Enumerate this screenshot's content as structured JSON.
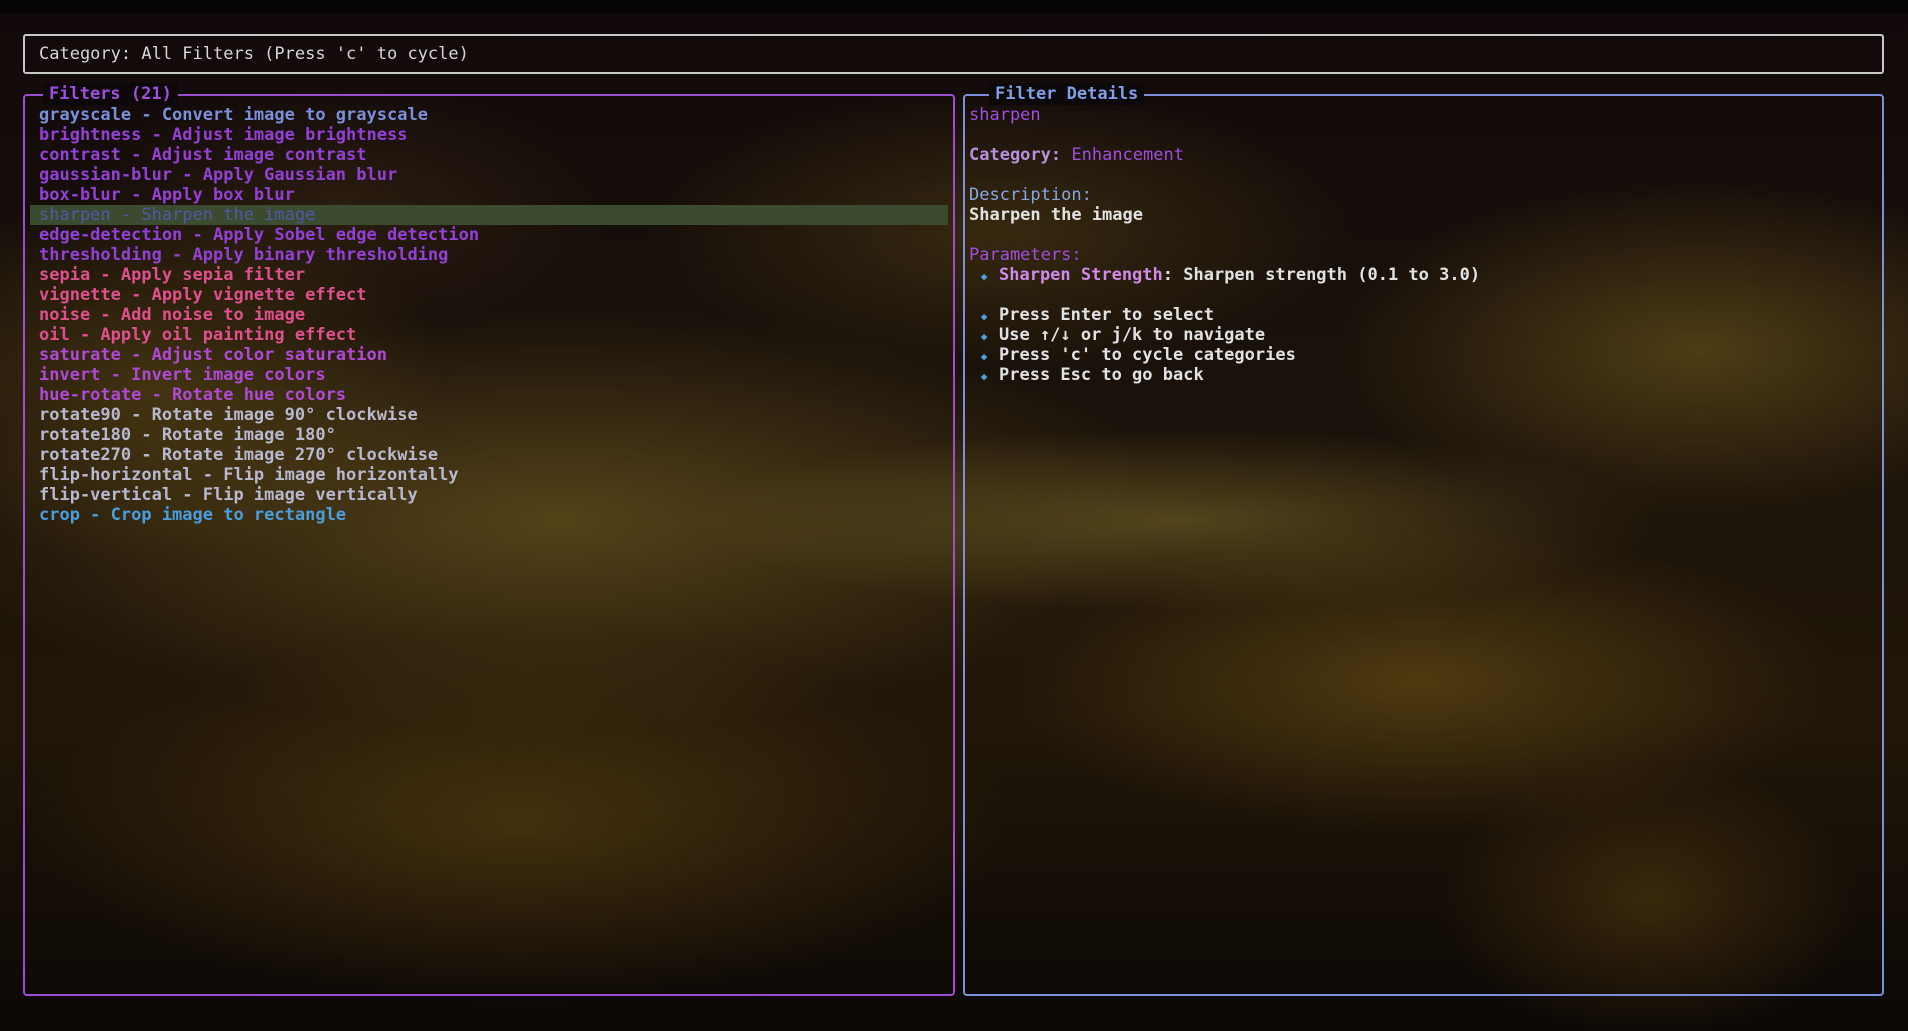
{
  "category_bar": {
    "text": "Category: All Filters (Press 'c' to cycle)"
  },
  "filters_panel": {
    "title": "Filters (21)",
    "selected_index": 5,
    "items": [
      {
        "text": "grayscale - Convert image to grayscale",
        "color": "#7b8fdc"
      },
      {
        "text": "brightness - Adjust image brightness",
        "color": "#9440d8"
      },
      {
        "text": "contrast - Adjust image contrast",
        "color": "#9440d8"
      },
      {
        "text": "gaussian-blur - Apply Gaussian blur",
        "color": "#9440d8"
      },
      {
        "text": "box-blur - Apply box blur",
        "color": "#9440d8"
      },
      {
        "text": "sharpen - Sharpen the image",
        "color": "#4f5aa8"
      },
      {
        "text": "edge-detection - Apply Sobel edge detection",
        "color": "#9440d8"
      },
      {
        "text": "thresholding - Apply binary thresholding",
        "color": "#9440d8"
      },
      {
        "text": "sepia - Apply sepia filter",
        "color": "#e0508e"
      },
      {
        "text": "vignette - Apply vignette effect",
        "color": "#e0508e"
      },
      {
        "text": "noise - Add noise to image",
        "color": "#e0508e"
      },
      {
        "text": "oil - Apply oil painting effect",
        "color": "#e0508e"
      },
      {
        "text": "saturate - Adjust color saturation",
        "color": "#b048d8"
      },
      {
        "text": "invert - Invert image colors",
        "color": "#b048d8"
      },
      {
        "text": "hue-rotate - Rotate hue colors",
        "color": "#b048d8"
      },
      {
        "text": "rotate90 - Rotate image 90° clockwise",
        "color": "#b8b8d0"
      },
      {
        "text": "rotate180 - Rotate image 180°",
        "color": "#b8b8d0"
      },
      {
        "text": "rotate270 - Rotate image 270° clockwise",
        "color": "#b8b8d0"
      },
      {
        "text": "flip-horizontal - Flip image horizontally",
        "color": "#b8b8d0"
      },
      {
        "text": "flip-vertical - Flip image vertically",
        "color": "#b8b8d0"
      },
      {
        "text": "crop - Crop image to rectangle",
        "color": "#4a9ee0"
      }
    ]
  },
  "details_panel": {
    "title": "Filter Details",
    "filter_name": "sharpen",
    "category_label": "Category:",
    "category_value": "Enhancement",
    "description_label": "Description:",
    "description_value": "Sharpen the image",
    "parameters_label": "Parameters:",
    "parameters": [
      {
        "name": "Sharpen Strength",
        "description": "Sharpen strength (0.1 to 3.0)"
      }
    ],
    "help": [
      "Press Enter to select",
      "Use ↑/↓ or j/k to navigate",
      "Press 'c' to cycle categories",
      "Press Esc to go back"
    ]
  },
  "colors": {
    "left_border": "#9b4fd0",
    "right_border": "#7d8fd8",
    "selection_bg": "#3c4a30",
    "bullet": "#4da0e0"
  }
}
